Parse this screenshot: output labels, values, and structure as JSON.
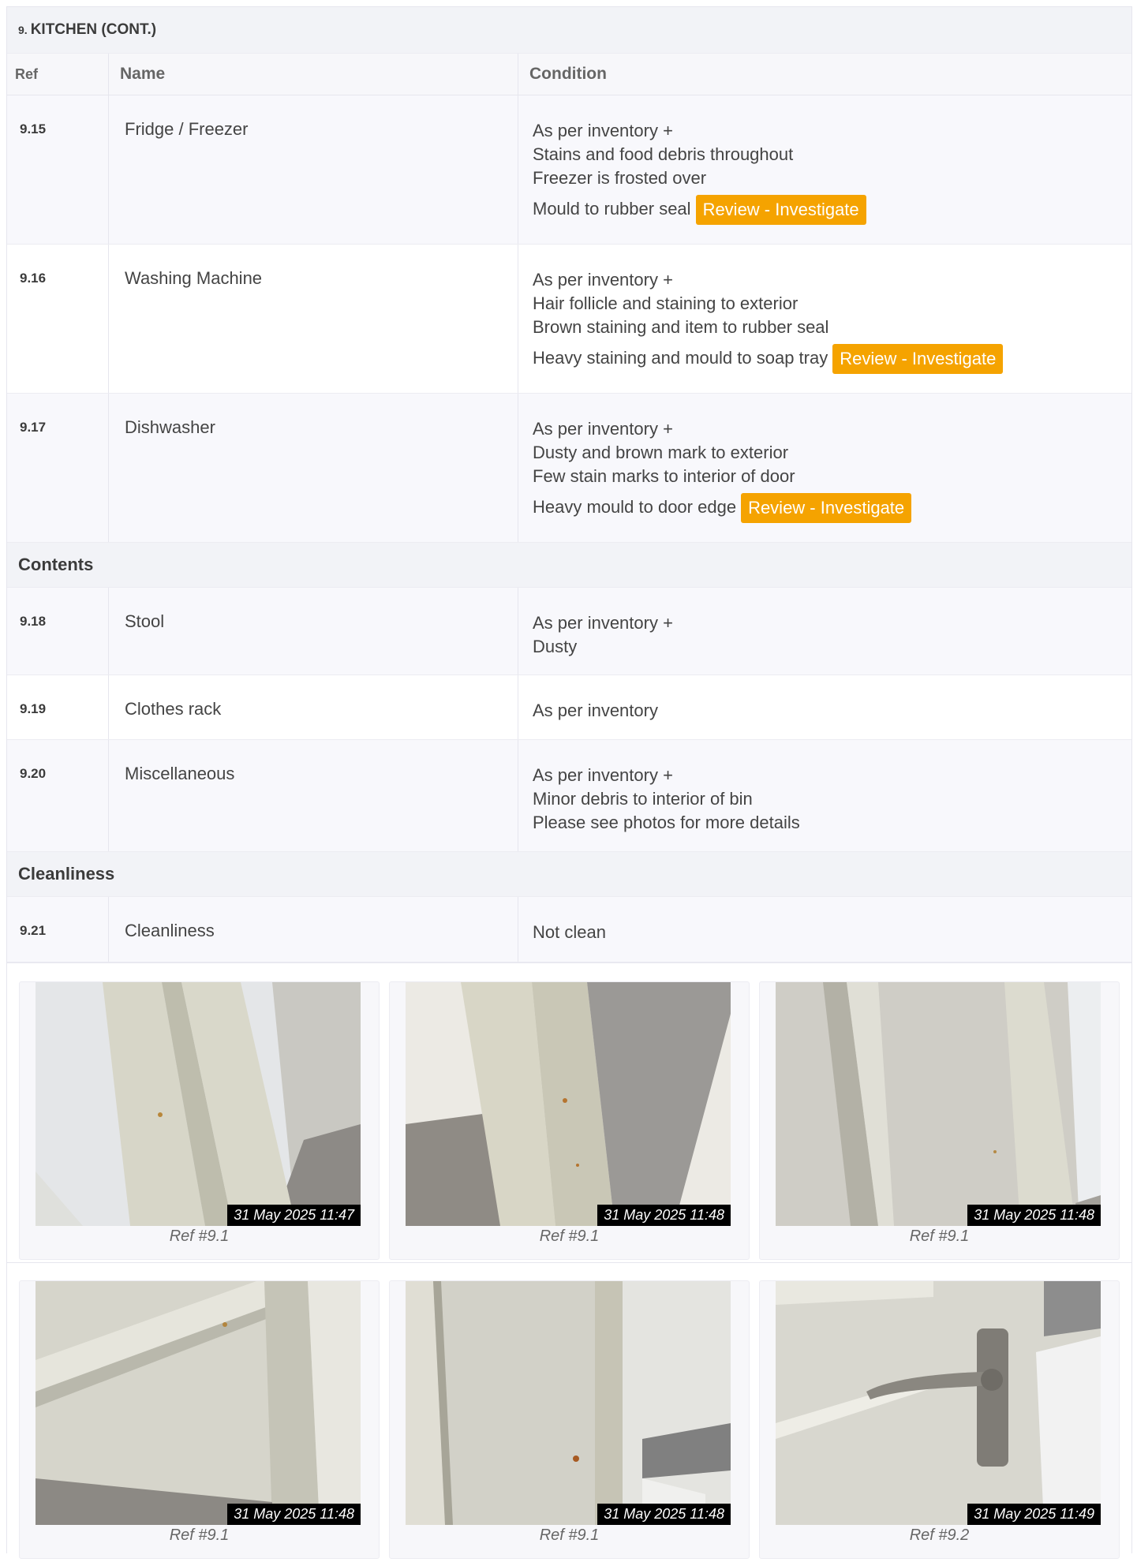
{
  "section": {
    "number": "9.",
    "title": "KITCHEN (CONT.)"
  },
  "columns": {
    "ref": "Ref",
    "name": "Name",
    "condition": "Condition"
  },
  "rows_a": [
    {
      "ref": "9.15",
      "name": "Fridge / Freezer",
      "lines": [
        "As per inventory +",
        "Stains and food debris throughout",
        "Freezer is frosted over"
      ],
      "flag_line": "Mould to rubber seal",
      "flag": "Review - Investigate"
    },
    {
      "ref": "9.16",
      "name": "Washing Machine",
      "lines": [
        "As per inventory +",
        "Hair follicle and staining to exterior",
        "Brown staining and item to rubber seal"
      ],
      "flag_line": "Heavy staining and mould to soap tray",
      "flag": "Review - Investigate"
    },
    {
      "ref": "9.17",
      "name": "Dishwasher",
      "lines": [
        "As per inventory +",
        "Dusty and brown mark to exterior",
        "Few stain marks to interior of door"
      ],
      "flag_line": "Heavy mould to door edge",
      "flag": "Review - Investigate"
    }
  ],
  "group_contents": "Contents",
  "rows_b": [
    {
      "ref": "9.18",
      "name": "Stool",
      "lines": [
        "As per inventory +",
        "Dusty"
      ]
    },
    {
      "ref": "9.19",
      "name": "Clothes rack",
      "lines": [
        "As per inventory"
      ]
    },
    {
      "ref": "9.20",
      "name": "Miscellaneous",
      "lines": [
        "As per inventory +",
        "Minor debris to interior of bin",
        "Please see photos for more details"
      ]
    }
  ],
  "group_cleanliness": "Cleanliness",
  "rows_c": [
    {
      "ref": "9.21",
      "name": "Cleanliness",
      "lines": [
        "Not clean"
      ]
    }
  ],
  "photos": [
    {
      "timestamp": "31 May 2025 11:47",
      "caption": "Ref #9.1"
    },
    {
      "timestamp": "31 May 2025 11:48",
      "caption": "Ref #9.1"
    },
    {
      "timestamp": "31 May 2025 11:48",
      "caption": "Ref #9.1"
    },
    {
      "timestamp": "31 May 2025 11:48",
      "caption": "Ref #9.1"
    },
    {
      "timestamp": "31 May 2025 11:48",
      "caption": "Ref #9.1"
    },
    {
      "timestamp": "31 May 2025 11:49",
      "caption": "Ref #9.2"
    }
  ],
  "colors": {
    "flag": "#f5a300",
    "header_bg": "#f2f3f7",
    "alt_row": "#f8f8fc"
  }
}
